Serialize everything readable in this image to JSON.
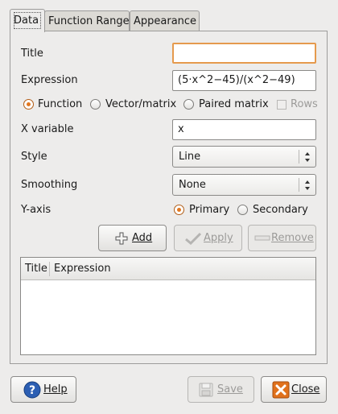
{
  "tabs": [
    {
      "label": "Data",
      "active": true
    },
    {
      "label": "Function Range",
      "active": false
    },
    {
      "label": "Appearance",
      "active": false
    }
  ],
  "form": {
    "title_label": "Title",
    "title_value": "",
    "expression_label": "Expression",
    "expression_value": "(5·x^2−45)/(x^2−49)",
    "type_options": [
      {
        "label": "Function",
        "selected": true
      },
      {
        "label": "Vector/matrix",
        "selected": false
      },
      {
        "label": "Paired matrix",
        "selected": false
      }
    ],
    "rows_label": "Rows",
    "xvar_label": "X variable",
    "xvar_value": "x",
    "style_label": "Style",
    "style_value": "Line",
    "smoothing_label": "Smoothing",
    "smoothing_value": "None",
    "yaxis_label": "Y-axis",
    "yaxis_options": [
      {
        "label": "Primary",
        "selected": true
      },
      {
        "label": "Secondary",
        "selected": false
      }
    ]
  },
  "actions": {
    "add": "Add",
    "apply": "Apply",
    "remove": "Remove"
  },
  "list": {
    "columns": [
      "Title",
      "Expression"
    ]
  },
  "footer": {
    "help": "Help",
    "save": "Save",
    "close": "Close"
  },
  "colors": {
    "focus": "#e59a4d",
    "radio_selected": "#e2771f",
    "help_icon": "#2c5fb3",
    "close_icon": "#e0711c"
  }
}
